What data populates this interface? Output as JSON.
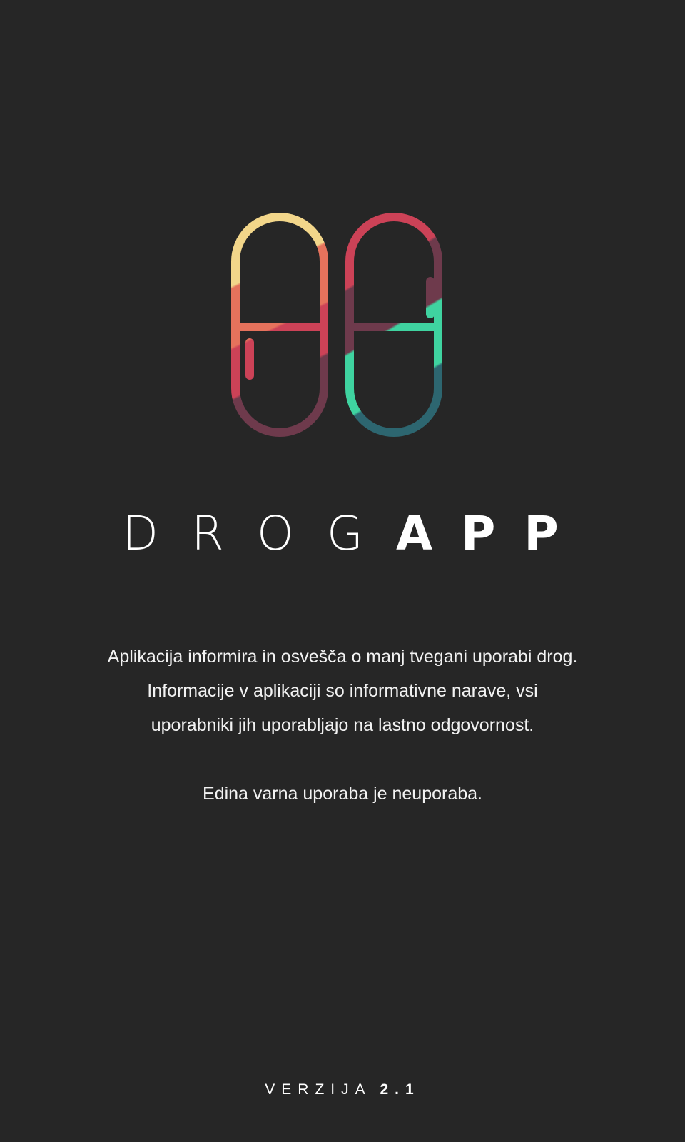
{
  "app": {
    "title_light": "DROG",
    "title_bold": "APP",
    "logo_name": "capsule-logo"
  },
  "description": {
    "paragraph": "Aplikacija informira in osvešča o manj tvegani uporabi drog. Informacije v aplikaciji so informa­tivne narave, vsi uporabniki jih uporabljajo na lastno odgovornost.",
    "tagline": "Edina varna uporaba je neuporaba."
  },
  "footer": {
    "version_label": "VERZIJA",
    "version_number": "2.1"
  },
  "colors": {
    "background": "#262626",
    "yellow": "#f2d68a",
    "orange": "#e5725c",
    "red": "#cc4257",
    "plum": "#6e3a4c",
    "teal": "#3fd3a0",
    "dark_teal": "#2d6670"
  }
}
